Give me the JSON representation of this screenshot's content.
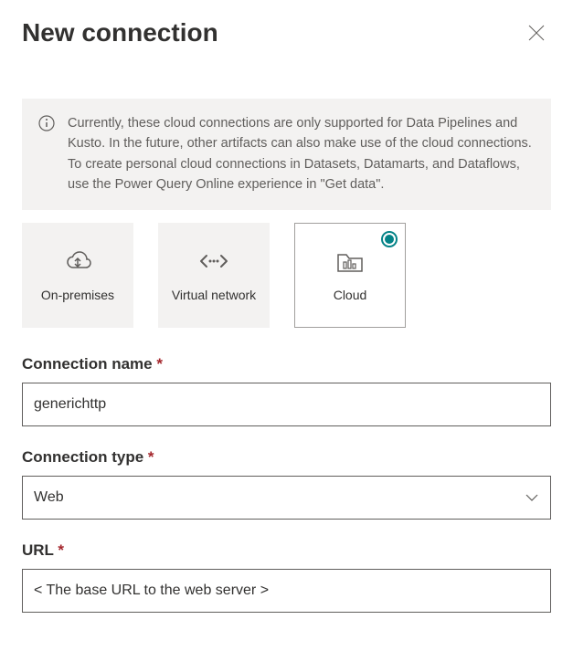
{
  "header": {
    "title": "New connection"
  },
  "info": {
    "text": "Currently, these cloud connections are only supported for Data Pipelines and Kusto. In the future, other artifacts can also make use of the cloud connections. To create personal cloud connections in Datasets, Datamarts, and Dataflows, use the Power Query Online experience in \"Get data\"."
  },
  "tiles": {
    "onprem": "On-premises",
    "vnet": "Virtual network",
    "cloud": "Cloud"
  },
  "fields": {
    "connection_name": {
      "label": "Connection name",
      "value": "generichttp"
    },
    "connection_type": {
      "label": "Connection type",
      "value": "Web"
    },
    "url": {
      "label": "URL",
      "value": "< The base URL to the web server >"
    }
  }
}
